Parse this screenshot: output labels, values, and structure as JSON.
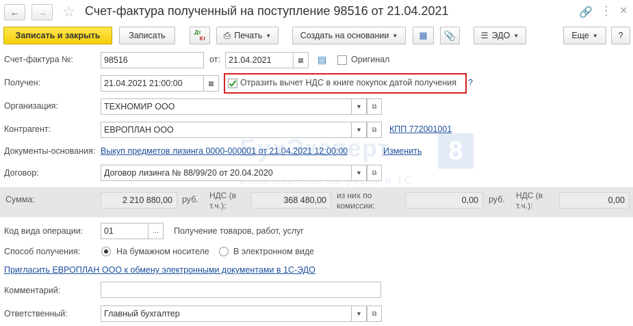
{
  "window": {
    "title": "Счет-фактура полученный на поступление 98516 от 21.04.2021",
    "back_icon": "arrow-left-icon",
    "forward_icon": "arrow-right-icon",
    "favorite_icon": "star-icon",
    "link_icon": "link-icon",
    "menu_icon": "more-vertical-icon",
    "close_label": "×"
  },
  "toolbar": {
    "save_close": "Записать и закрыть",
    "save": "Записать",
    "dtkt_top": "Дт",
    "dtkt_bottom": "Кт",
    "print": "Печать",
    "create_based": "Создать на основании",
    "edo": "ЭДО",
    "more": "Еще",
    "help": "?"
  },
  "form": {
    "invoice_number_label": "Счет-фактура №:",
    "invoice_number": "98516",
    "date_from_label": "от:",
    "invoice_date": "21.04.2021",
    "original_label": "Оригинал",
    "received_label": "Получен:",
    "received_datetime": "21.04.2021 21:00:00",
    "vat_deduction_label": "Отразить вычет НДС в книге покупок датой получения",
    "vat_deduction_checked": true,
    "vat_help": "?",
    "organization_label": "Организация:",
    "organization": "ТЕХНОМИР ООО",
    "counterparty_label": "Контрагент:",
    "counterparty": "ЕВРОПЛАН ООО",
    "kpp_link": "КПП 772001001",
    "base_docs_label": "Документы-основания:",
    "base_docs_link": "Выкуп предметов лизинга 0000-000001 от 21.04.2021 12:00:00",
    "change_link": "Изменить",
    "contract_label": "Договор:",
    "contract": "Договор лизинга № 88/99/20 от 20.04.2020",
    "operation_code_label": "Код вида операции:",
    "operation_code": "01",
    "operation_code_desc": "Получение товаров, работ, услуг",
    "receipt_method_label": "Способ получения:",
    "receipt_paper": "На бумажном носителе",
    "receipt_electronic": "В электронном виде",
    "invite_link": "Пригласить ЕВРОПЛАН ООО к обмену электронными документами в 1С-ЭДО",
    "comment_label": "Комментарий:",
    "comment": "",
    "responsible_label": "Ответственный:",
    "responsible": "Главный бухгалтер"
  },
  "sums": {
    "sum_label": "Сумма:",
    "sum": "2 210 880,00",
    "currency": "руб.",
    "vat_label_1": "НДС (в",
    "vat_label_2": "т.ч.):",
    "vat": "368 480,00",
    "commission_label_1": "из них по",
    "commission_label_2": "комиссии:",
    "commission_sum": "0,00",
    "commission_currency": "руб.",
    "commission_vat_label_1": "НДС (в",
    "commission_vat_label_2": "т.ч.):",
    "commission_vat": "0,00"
  },
  "watermark": {
    "brand": "БухЭксперт",
    "digit": "8",
    "tagline": "База ответов по учёту в 1С"
  },
  "colors": {
    "primary_button": "#f5cf0a",
    "link": "#1c4f9c",
    "highlight_border": "#d42020",
    "check_mark": "#2e9a3a"
  }
}
